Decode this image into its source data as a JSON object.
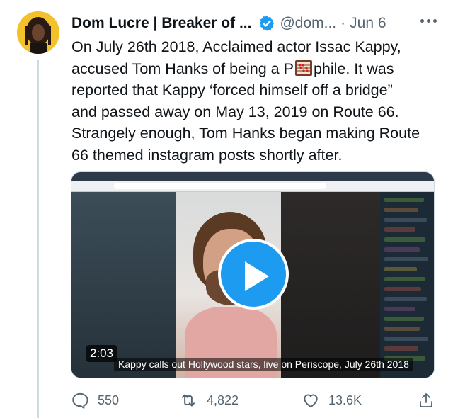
{
  "author": {
    "name": "Dom Lucre | Breaker of ...",
    "handle": "@dom...",
    "separator": "·",
    "date": "Jun 6",
    "verified": true
  },
  "tweet": {
    "lines": [
      "On July 26th 2018, Acclaimed actor Issac Kappy,",
      "phile. It was",
      "reported that Kappy ‘forced himself off a bridge”",
      "and passed away on May 13, 2019 on Route 66.",
      "Strangely enough, Tom Hanks began making Route",
      "66 themed instagram posts shortly after."
    ],
    "line2_prefix": "accused Tom Hanks of being a P",
    "emoji_name": "abacus-emoji"
  },
  "media": {
    "duration": "2:03",
    "caption": "Kappy calls out Hollywood stars, live on Periscope, July 26th 2018"
  },
  "actions": {
    "replies": "550",
    "retweets": "4,822",
    "likes": "13.6K"
  },
  "colors": {
    "accent": "#1d9bf0",
    "text": "#0f1419",
    "secondary": "#536471"
  },
  "icons": [
    "verified-badge-icon",
    "more-icon",
    "reply-icon",
    "retweet-icon",
    "like-icon",
    "share-icon",
    "play-icon"
  ]
}
